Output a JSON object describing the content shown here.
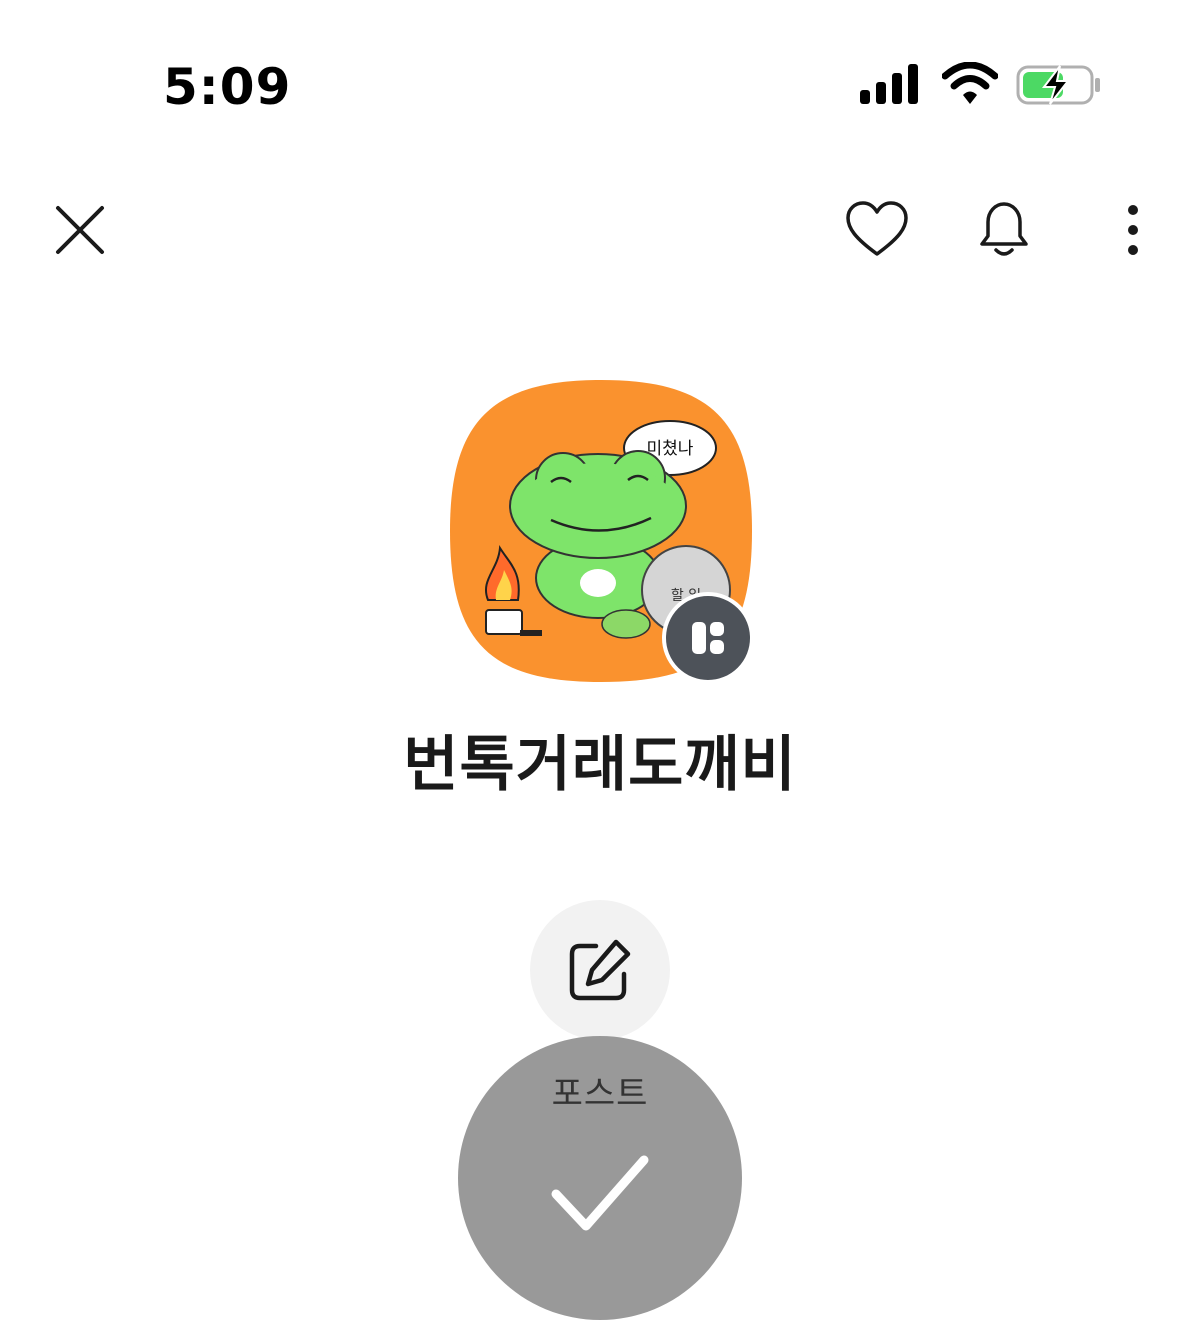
{
  "status_bar": {
    "time": "5:09",
    "icons": [
      "cellular-signal-icon",
      "wifi-icon",
      "battery-charging-icon"
    ],
    "battery_color": "#4cd964"
  },
  "top_bar": {
    "icons": [
      "close-icon",
      "heart-icon",
      "bell-icon",
      "more-vertical-icon"
    ]
  },
  "profile": {
    "avatar_bg_color": "#fa922e",
    "avatar_speech_bubble": "미쳤나",
    "avatar_bag_text": "할 일",
    "badge_icon": "channel-layout-icon",
    "name": "번톡거래도깨비"
  },
  "actions": {
    "write_icon": "edit-icon",
    "post_label": "포스트",
    "fab_icon": "check-icon"
  }
}
